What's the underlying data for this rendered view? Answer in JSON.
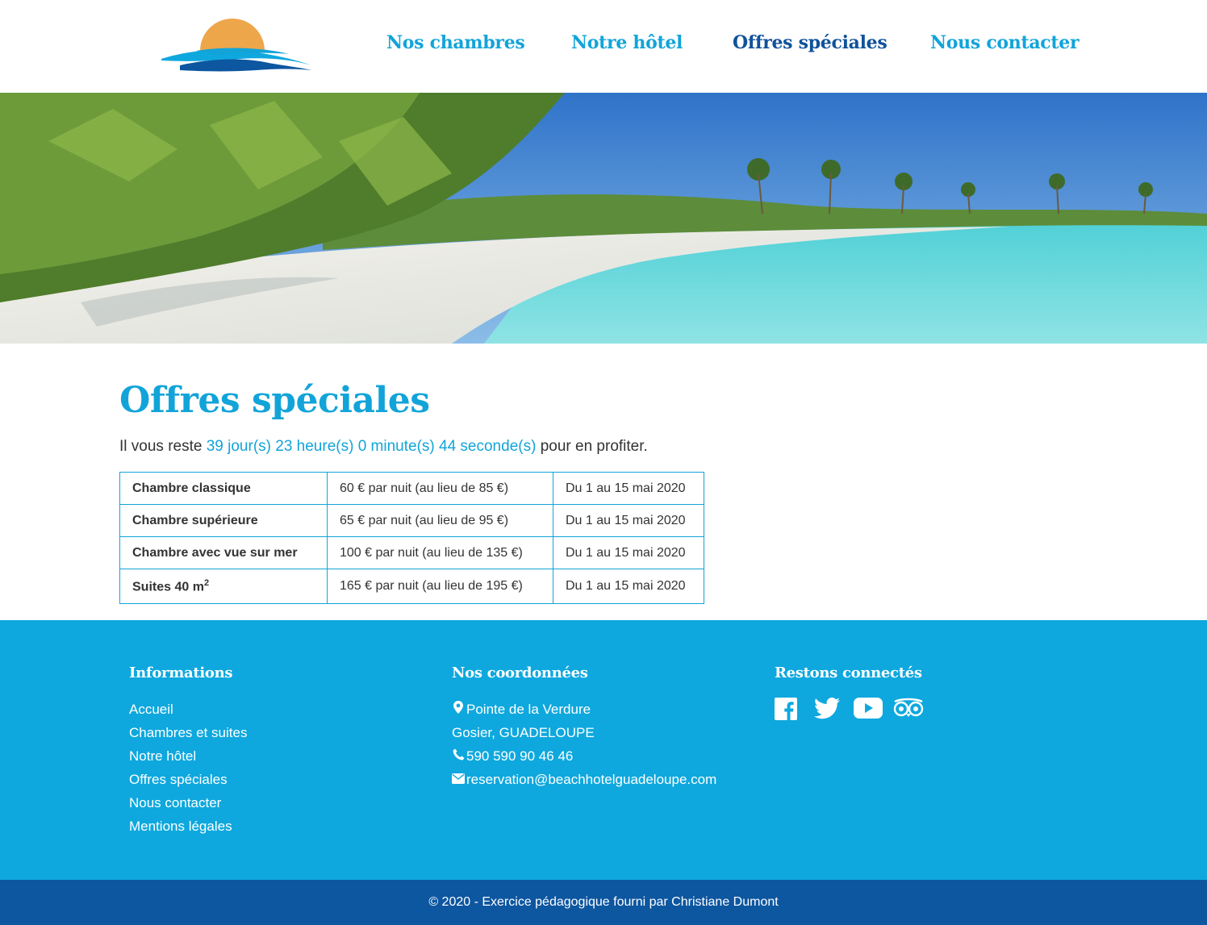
{
  "nav": {
    "items": [
      {
        "label": "Nos chambres",
        "active": false
      },
      {
        "label": "Notre hôtel",
        "active": false
      },
      {
        "label": "Offres spéciales",
        "active": true
      },
      {
        "label": "Nous contacter",
        "active": false
      }
    ]
  },
  "main": {
    "title": "Offres spéciales",
    "countdown": {
      "prefix": "Il vous reste",
      "days": "39 jour(s)",
      "hours": "23 heure(s)",
      "minutes": "0 minute(s)",
      "seconds": "44 seconde(s)",
      "suffix": "pour en profiter."
    },
    "offers": [
      {
        "name": "Chambre classique",
        "price": "60 € par nuit (au lieu de 85 €)",
        "dates": "Du 1 au 15 mai 2020"
      },
      {
        "name": "Chambre supérieure",
        "price": "65 € par nuit (au lieu de 95 €)",
        "dates": "Du 1 au 15 mai 2020"
      },
      {
        "name": "Chambre avec vue sur mer",
        "price": "100 € par nuit (au lieu de 135 €)",
        "dates": "Du 1 au 15 mai 2020"
      },
      {
        "name": "Suites 40 m",
        "name_sup": "2",
        "price": "165 € par nuit (au lieu de 195 €)",
        "dates": "Du 1 au 15 mai 2020"
      }
    ]
  },
  "footer": {
    "info": {
      "title": "Informations",
      "links": [
        "Accueil",
        "Chambres et suites",
        "Notre hôtel",
        "Offres spéciales",
        "Nous contacter",
        "Mentions légales"
      ]
    },
    "contact": {
      "title": "Nos coordonnées",
      "address1": "Pointe de la Verdure",
      "address2": "Gosier, GUADELOUPE",
      "phone": "590 590 90 46 46",
      "email": "reservation@beachhotelguadeloupe.com"
    },
    "social": {
      "title": "Restons connectés",
      "icons": [
        "facebook-icon",
        "twitter-icon",
        "youtube-icon",
        "tripadvisor-icon"
      ]
    },
    "copyright": "© 2020 - Exercice pédagogique fourni par Christiane Dumont"
  },
  "colors": {
    "accent": "#12a4d9",
    "active_nav": "#10529b",
    "footer_bg": "#0ea8de",
    "bottom_bar_bg": "#0d56a0",
    "sun": "#eea64b"
  }
}
